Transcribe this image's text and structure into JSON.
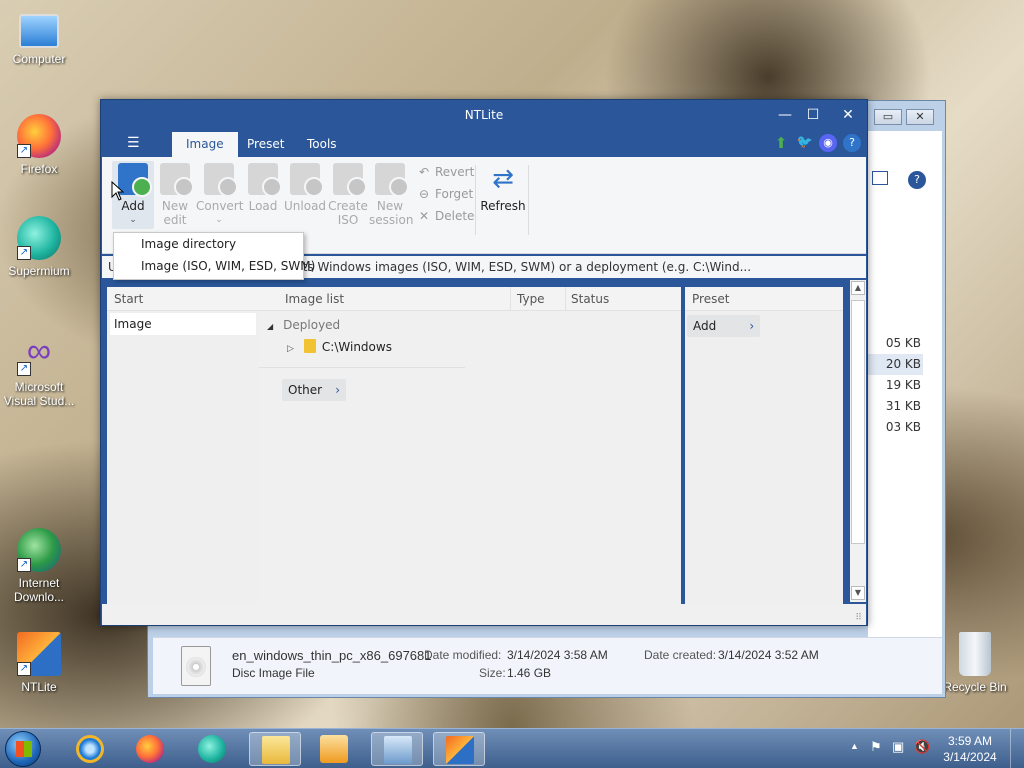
{
  "desktop": {
    "icons": [
      {
        "label": "Computer",
        "icon": "computer-icon"
      },
      {
        "label": "Firefox",
        "icon": "firefox-icon"
      },
      {
        "label": "Supermium",
        "icon": "supermium-icon"
      },
      {
        "label_line1": "Microsoft",
        "label_line2": "Visual Stud...",
        "icon": "visual-studio-icon"
      },
      {
        "label_line1": "Internet",
        "label_line2": "Downlo...",
        "icon": "internet-download-manager-icon"
      },
      {
        "label": "NTLite",
        "icon": "ntlite-icon"
      },
      {
        "label": "Recycle Bin",
        "icon": "recycle-bin-icon"
      }
    ]
  },
  "explorer": {
    "sizes": [
      "05 KB",
      "20 KB",
      "19 KB",
      "31 KB",
      "03 KB"
    ],
    "details": {
      "filename": "en_windows_thin_pc_x86_697681",
      "filetype": "Disc Image File",
      "date_modified_label": "Date modified:",
      "date_modified": "3/14/2024 3:58 AM",
      "size_label": "Size:",
      "size": "1.46 GB",
      "date_created_label": "Date created:",
      "date_created": "3/14/2024 3:52 AM"
    }
  },
  "ntlite": {
    "title": "NTLite",
    "menu": {
      "tabs": [
        "Image",
        "Preset",
        "Tools"
      ],
      "active": "Image"
    },
    "ribbon": {
      "add": "Add",
      "new_edit": [
        "New",
        "edit"
      ],
      "convert": "Convert",
      "load": "Load",
      "unload": "Unload",
      "create_iso": [
        "Create",
        "ISO"
      ],
      "new_session": [
        "New",
        "session"
      ],
      "revert": "Revert",
      "forget": "Forget",
      "delete": "Delete",
      "refresh": "Refresh"
    },
    "add_menu": [
      "Image directory",
      "Image (ISO, WIM, ESD, SWM)"
    ],
    "info_text": "U                                              hem using the toolbar. Supports Windows images (ISO, WIM, ESD, SWM) or a deployment (e.g. C:\\Wind...",
    "start_panel": {
      "header": "Start",
      "items": [
        "Image"
      ]
    },
    "image_list": {
      "columns": [
        "Image list",
        "Type",
        "Status"
      ],
      "group": "Deployed",
      "item": "C:\\Windows",
      "other": "Other"
    },
    "preset_panel": {
      "header": "Preset",
      "add": "Add"
    }
  },
  "taskbar": {
    "time": "3:59 AM",
    "date": "3/14/2024"
  },
  "colors": {
    "ntlite_blue": "#2b579a",
    "taskbar": "#4a6b97"
  }
}
